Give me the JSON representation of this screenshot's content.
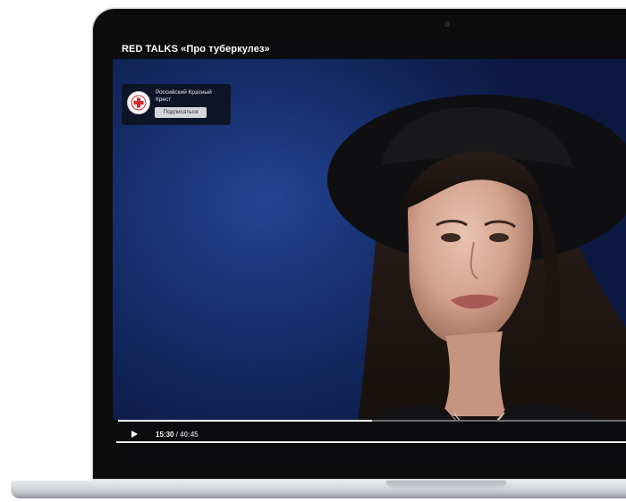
{
  "video": {
    "title": "RED TALKS «Про туберкулез»",
    "progress_fraction": 0.5
  },
  "channel": {
    "name": "Российский Красный Крест",
    "subscribe_label": "Подписаться",
    "logo_icon": "red-cross-icon",
    "brand_color": "#d62828"
  },
  "player": {
    "play_icon": "play-icon",
    "current_time": "15:30",
    "separator": " / ",
    "total_time": "40:45"
  }
}
